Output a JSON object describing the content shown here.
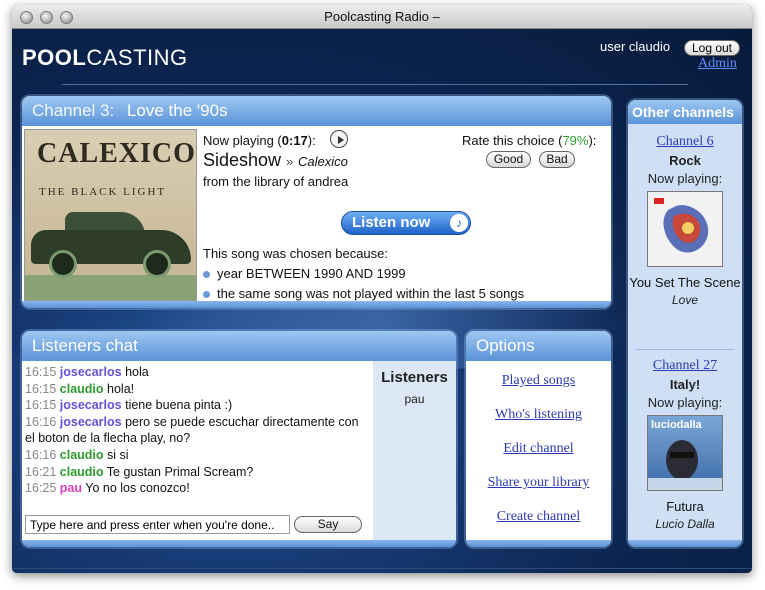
{
  "window": {
    "title": "Poolcasting Radio –"
  },
  "header": {
    "logo_bold": "POOL",
    "logo_light": "CASTING",
    "user_label": "user claudio",
    "logout_label": "Log out",
    "admin_label": "Admin"
  },
  "channel": {
    "number_label": "Channel 3:",
    "name": "Love the '90s",
    "album_art_band": "CALEXICO",
    "album_art_subtitle": "THE BLACK LIGHT",
    "now_playing_prefix": "Now playing (",
    "elapsed": "0:17",
    "now_playing_suffix": "):",
    "song": "Sideshow",
    "separator": "»",
    "artist": "Calexico",
    "library_label": "from the library of andrea",
    "rate_prefix": "Rate this choice (",
    "rate_pct": "79%",
    "rate_suffix": "):",
    "good_label": "Good",
    "bad_label": "Bad",
    "listen_label": "Listen now",
    "because_label": "This song was chosen because:",
    "reasons": [
      "year BETWEEN 1990 AND 1999",
      "the same song was not played within the last 5 songs"
    ]
  },
  "chat": {
    "title": "Listeners chat",
    "messages": [
      {
        "time": "16:15",
        "user": "josecarlos",
        "text": "hola"
      },
      {
        "time": "16:15",
        "user": "claudio",
        "text": "hola!"
      },
      {
        "time": "16:15",
        "user": "josecarlos",
        "text": "tiene buena pinta :)"
      },
      {
        "time": "16:16",
        "user": "josecarlos",
        "text": "pero se puede escuchar directamente con el boton de la flecha play, no?"
      },
      {
        "time": "16:16",
        "user": "claudio",
        "text": "si si"
      },
      {
        "time": "16:21",
        "user": "claudio",
        "text": "Te gustan Primal Scream?"
      },
      {
        "time": "16:25",
        "user": "pau",
        "text": "Yo no los conozco!"
      }
    ],
    "input_placeholder": "Type here and press enter when you're done..",
    "say_label": "Say",
    "listeners_title": "Listeners",
    "listeners": [
      "pau"
    ],
    "user_colors": {
      "josecarlos": "#6a4fd8",
      "claudio": "#2e9a2e",
      "pau": "#d63fc0"
    }
  },
  "options": {
    "title": "Options",
    "links": [
      "Played songs",
      "Who's listening",
      "Edit channel",
      "Share your library",
      "Create channel"
    ]
  },
  "other_channels": {
    "title": "Other channels",
    "now_playing_label": "Now playing:",
    "items": [
      {
        "channel": "Channel 6",
        "name": "Rock",
        "song": "You Set The Scene",
        "artist": "Love"
      },
      {
        "channel": "Channel 27",
        "name": "Italy!",
        "song": "Futura",
        "artist": "Lucio Dalla",
        "art_text": "luciodalla"
      }
    ]
  }
}
